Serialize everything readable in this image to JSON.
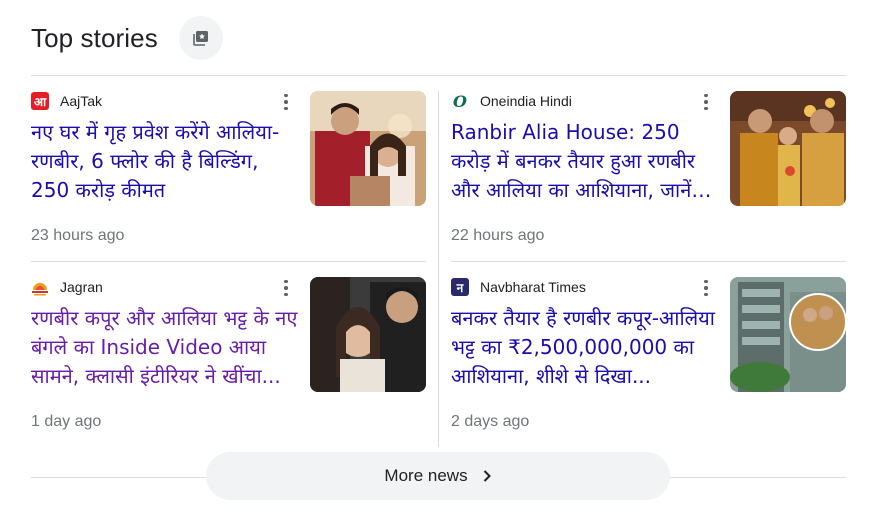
{
  "header": {
    "title": "Top stories",
    "icon": "feedback-icon"
  },
  "stories": [
    {
      "source": "AajTak",
      "logo_text": "आ",
      "logo_color": "#e31e24",
      "headline": "नए घर में गृह प्रवेश करेंगे आलिया-रणबीर, 6 फ्लोर की है बिल्डिंग, 250 करोड़ कीमत",
      "time": "23 hours ago",
      "visited": false
    },
    {
      "source": "Oneindia Hindi",
      "logo_text": "O",
      "logo_color": "#0b6e4f",
      "headline": "Ranbir Alia House: 250 करोड़ में बनकर तैयार हुआ रणबीर और आलिया का आशियाना, जानें क...",
      "time": "22 hours ago",
      "visited": false
    },
    {
      "source": "Jagran",
      "logo_text": "",
      "logo_color": "#f39c12",
      "headline": "रणबीर कपूर और आलिया भट्ट के नए बंगले का Inside Video आया सामने, क्लासी इंटीरियर ने खींचा...",
      "time": "1 day ago",
      "visited": true
    },
    {
      "source": "Navbharat Times",
      "logo_text": "न",
      "logo_color": "#2a2a6a",
      "headline": "बनकर तैयार है रणबीर कपूर-आलिया भट्ट का ₹2,500,000,000 का आशियाना, शीशे से दिखा...",
      "time": "2 days ago",
      "visited": false
    }
  ],
  "more_button": {
    "label": "More news",
    "icon": "chevron-right-icon"
  }
}
